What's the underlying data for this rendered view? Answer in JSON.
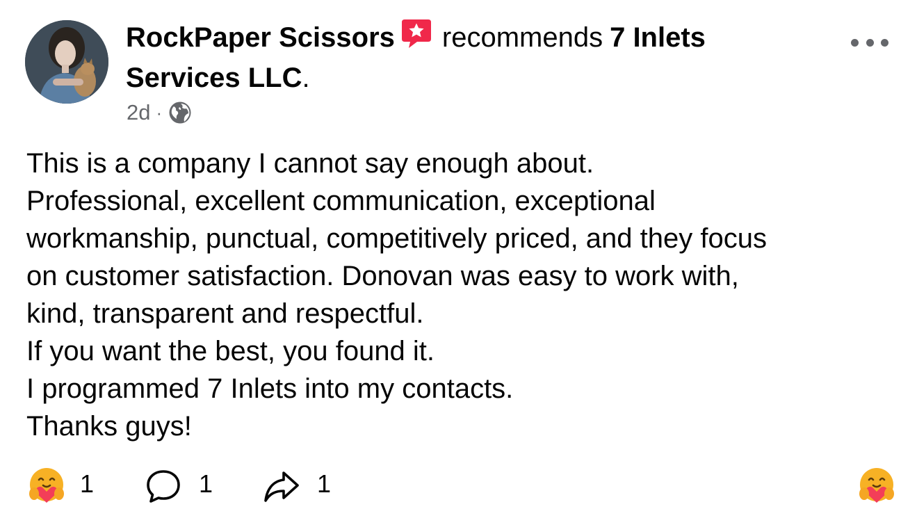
{
  "post": {
    "author": "RockPaper Scissors",
    "action": "recommends",
    "page": "7 Inlets Services LLC",
    "period": ".",
    "time": "2d",
    "separator": "·",
    "privacy_icon": "globe-icon",
    "menu_icon": "more-options-icon",
    "body_lines": [
      "This is a company I cannot say enough about.",
      "Professional, excellent communication, exceptional",
      "workmanship, punctual, competitively priced, and they focus",
      "on customer satisfaction. Donovan was easy to work with,",
      "kind, transparent and respectful.",
      "If you want the best, you found it.",
      "I programmed 7 Inlets into my contacts.",
      "Thanks guys!"
    ]
  },
  "footer": {
    "reaction_count": "1",
    "comment_count": "1",
    "share_count": "1",
    "reaction_icon": "care-emoji-icon",
    "comment_icon": "comment-icon",
    "share_icon": "share-icon"
  },
  "colors": {
    "text": "#050505",
    "secondary": "#65676b",
    "recommend_badge": "#f0284a",
    "care_emoji": "#f7b125",
    "heart": "#f33e58"
  }
}
